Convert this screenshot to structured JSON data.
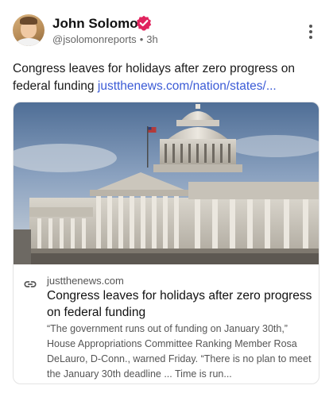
{
  "author": {
    "name": "John Solomon",
    "handle": "@jsolomonreports",
    "separator": "•",
    "time": "3h",
    "verified_color": "#e0245e"
  },
  "post": {
    "text": "Congress leaves for holidays after zero progress on federal funding",
    "link_text": "justthenews.com/nation/states/..."
  },
  "card": {
    "domain": "justthenews.com",
    "title": "Congress leaves for holidays after zero progress on federal funding",
    "description": "“The government runs out of funding on January 30th,” House Appropriations Committee Ranking Member Rosa DeLauro, D-Conn., warned Friday. “There is no plan to meet the January 30th deadline ... Time is run..."
  },
  "icons": {
    "verified": "verified-badge-icon",
    "more": "more-vertical-icon",
    "link": "link-icon"
  },
  "colors": {
    "link": "#3b5bd6",
    "secondary_text": "#666666"
  }
}
